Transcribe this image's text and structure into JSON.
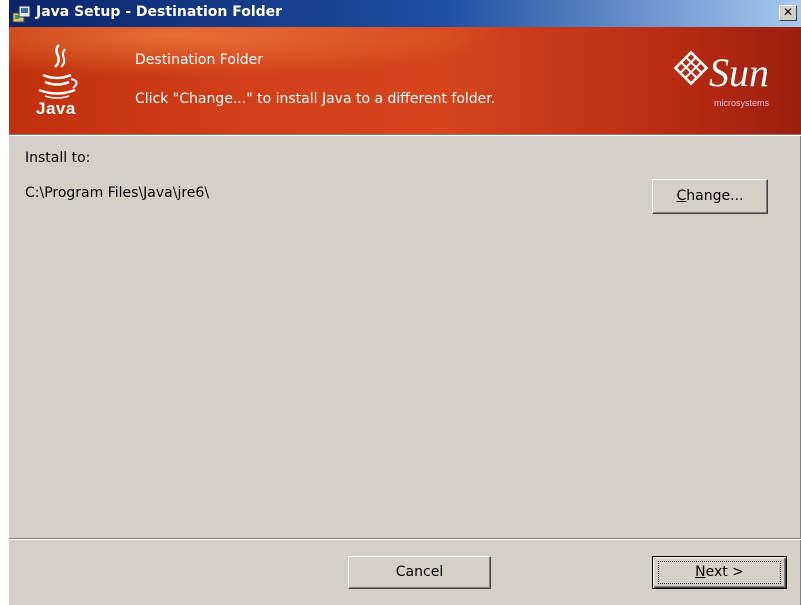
{
  "window": {
    "title": "Java Setup - Destination Folder",
    "close_label": "✕"
  },
  "banner": {
    "title": "Destination Folder",
    "description": "Click \"Change...\" to install Java to a different folder.",
    "java_logo_text": "Java",
    "sun_logo_text": "Sun",
    "sun_logo_subtext": "microsystems"
  },
  "content": {
    "install_label": "Install to:",
    "install_path": "C:\\Program Files\\Java\\jre6\\",
    "change_button": {
      "mnemonic": "C",
      "rest": "hange..."
    }
  },
  "footer": {
    "cancel_label": "Cancel",
    "next_button": {
      "mnemonic": "N",
      "rest": "ext >"
    }
  },
  "colors": {
    "titlebar_start": "#0a246a",
    "titlebar_end": "#a6caf0",
    "banner": "#d6451c",
    "dialog_bg": "#d4d0c8"
  }
}
